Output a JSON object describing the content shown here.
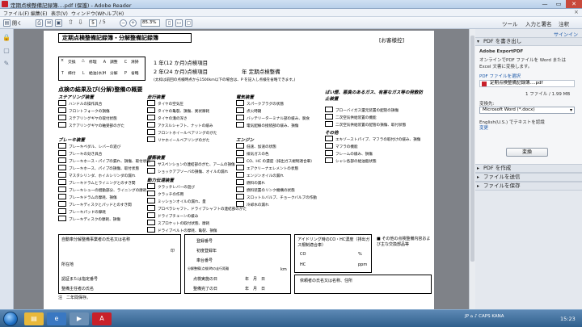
{
  "window": {
    "title": "定期点検整備記録簿....pdf (保護) - Adobe Reader",
    "min": "—",
    "max": "▭",
    "close": "✕"
  },
  "menu": {
    "items": [
      "ファイル(F)",
      "編集(E)",
      "表示(V)",
      "ウィンドウ(W)",
      "ヘルプ(H)"
    ],
    "close": "×"
  },
  "toolbar": {
    "open_label": "開く",
    "page_current": "5",
    "page_total": "/ 5",
    "zoom": "85.3%",
    "tools": "ツール",
    "fill_sign": "入力と署名",
    "comment": "注釈"
  },
  "right_panel": {
    "signin": "サインイン",
    "section_pdf_export": "PDF を書き出し",
    "export_title": "Adobe ExportPDF",
    "export_desc": "オンラインでPDF ファイルを Word または Excel 文書に変換します。",
    "select_pdf": "PDF ファイルを選択",
    "file_name": "定期点検整備記録簿....pdf",
    "file_count": "1 ファイル / 1.99 MB",
    "convert_to": "変換先:",
    "convert_format": "Microsoft Word (*.docx)",
    "language": "English(U.S.) でテキストを認識",
    "change": "変更",
    "convert_button": "変換",
    "section_create": "PDF を作成",
    "section_send": "ファイルを送信",
    "section_save": "ファイルを保存"
  },
  "document": {
    "title": "定期点検整備記録簿・分解整備記録簿",
    "customer": "[お客様控]",
    "grid_labels": [
      "×",
      "交換",
      "△",
      "修理",
      "Ａ",
      "調整",
      "Ｃ",
      "清掃",
      "Ｔ",
      "締付",
      "Ｌ",
      "給油(水)",
      "Ｈ",
      "分解",
      "Ｐ",
      "省略"
    ],
    "inspect_12": "1 年(12 か月)点検項目",
    "inspect_24": "2 年(24 か月)点検項目",
    "year_mark": "年 定期点検整備",
    "note_top": "(太枠は前回の点検時点から1500km以下の場合は、P を記入し点検を省略できます。)",
    "section_main": "点検の結果及び(分解)整備の概要",
    "steering": {
      "head": "ステアリング装置",
      "items": [
        "ハンドルの操作具合",
        "フロントフォークの損傷",
        "ステアリングギヤの取付状態",
        "ステアリングギヤの軸受部のがた"
      ]
    },
    "brake": {
      "head": "ブレーキ装置",
      "items": [
        "ブレーキペダル、レバーの遊び",
        "ブレーキの効き具合",
        "ブレーキホース・パイプの漏れ、損傷、取付状態",
        "ブレーキホース、パイプの損傷、取付状態",
        "マスタシリンダ、ホイルシリンダの漏れ",
        "ブレーキドラムとライニングとのすき間",
        "ブレーキシューの摺動部分、ライニングの摩耗",
        "ブレーキドラムの摩耗、損傷",
        "ブレーキディスクとパッドとのすき間",
        "ブレーキパッドの摩耗",
        "ブレーキディスクの摩耗、損傷"
      ]
    },
    "travel": {
      "head": "走行装置",
      "items": [
        "タイヤの空気圧",
        "タイヤの亀裂、損傷、異状摩耗",
        "タイヤの溝の深さ",
        "アクスルシャフト、ナットの緩み",
        "フロントホイールベアリングのがた",
        "リヤホイールベアリングのがた"
      ]
    },
    "buffer": {
      "head": "緩衝装置",
      "items": [
        "サスペンションの連結部のがた、アームの損傷",
        "ショックアブソーバの損傷、オイルの漏れ"
      ]
    },
    "power": {
      "head": "動力伝達装置",
      "items": [
        "クラッチレバーの遊び",
        "クラッチの作用",
        "ミッションオイルの漏れ、量",
        "プロペラシャフト、ドライブシャフトの連結部のがた",
        "ドライブチェーンの緩み",
        "スプロケットの取付状態、摩耗",
        "ドライブベルトの摩耗、亀裂、損傷"
      ]
    },
    "electric": {
      "head": "電気装置",
      "items": [
        "スパークプラグの状態",
        "点火時期",
        "バッテリーターミナル部の緩み、腐食",
        "電気配線の接続部の緩み、損傷"
      ]
    },
    "engine": {
      "head": "エンジン",
      "items": [
        "低速、加速の状態",
        "排気ガスの色",
        "CO、HC の濃度（排出ガス規制適合車）",
        "エアクリーナエレメントの状態",
        "エンジンオイルの漏れ",
        "燃料の漏れ",
        "燃料装置のリンク機構の状態",
        "スロットルバルブ、チョークバルブの作動",
        "冷却水の漏れ"
      ]
    },
    "smoke": {
      "head": "ばい煙、悪臭のあるガス、有害なガス等の発散防止装置",
      "items": [
        "ブローバイガス還元装置の配管の損傷",
        "二次空気供給装置の機能",
        "二次空気供給装置の配管の損傷、取付状態"
      ]
    },
    "other": {
      "head": "その他",
      "items": [
        "エキゾーストパイプ、マフラの取付けの緩み、損傷",
        "マフラの機能",
        "フレームの緩み、損傷",
        "シャシ各部の給油脂状態"
      ]
    },
    "bottom": {
      "inspector": "自動車分解整備事業者の氏名又は名称",
      "seal": "印",
      "address": "所在地",
      "cert_no": "認証または指定番号",
      "chief": "整備主任者の氏名",
      "reg_no": "登録番号",
      "first_reg": "初度登録年",
      "chassis": "車台番号",
      "odo": "分解整備(点検)時の走行距離",
      "km": "km",
      "inspect_date": "点検実施の日",
      "complete_date": "整備完了の日",
      "ymd": "年　月　日",
      "co_hc": "アイドリング時のCO・HC濃度（排出ガス規制適合車）",
      "co": "CO",
      "pct": "%",
      "hc": "HC",
      "ppm": "ppm",
      "other_note": "■ その他の点検整備内容および主な交換部品等",
      "client": "依頼者の氏名又は名称、住所"
    },
    "footnote": "注　二年間保存。"
  },
  "taskbar": {
    "tray": "JP ⌂ ♪ CAPS KANA",
    "clock": "15:23"
  }
}
